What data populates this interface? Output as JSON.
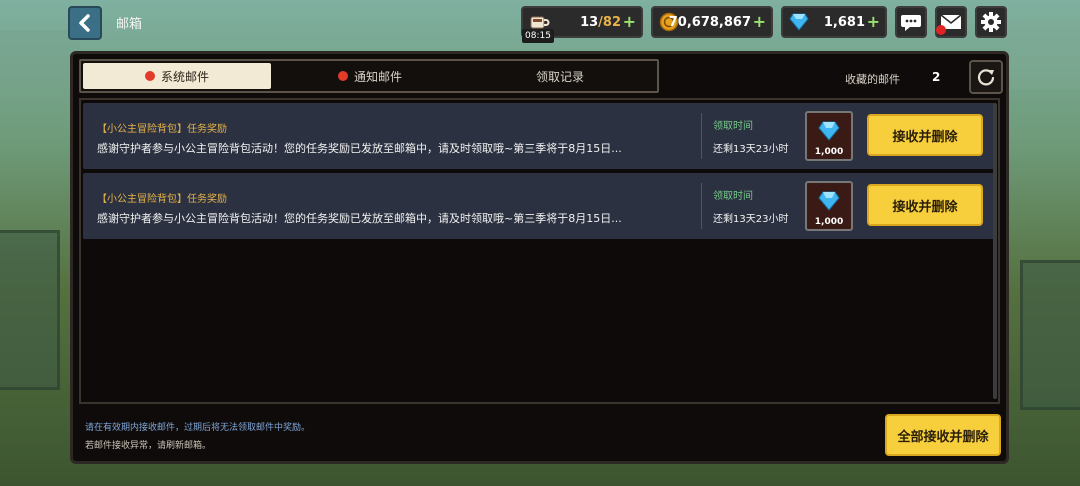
{
  "header": {
    "title": "邮箱"
  },
  "resources": {
    "stamina": {
      "current": "13",
      "max": "/82",
      "timer": "08:15",
      "icon": "coffee-cup-icon"
    },
    "coins": {
      "value": "70,678,867",
      "icon": "coin-icon"
    },
    "gems": {
      "value": "1,681",
      "icon": "diamond-icon"
    }
  },
  "tabs": [
    {
      "label": "系统邮件",
      "active": true,
      "has_dot": true
    },
    {
      "label": "通知邮件",
      "active": false,
      "has_dot": true
    },
    {
      "label": "领取记录",
      "active": false,
      "has_dot": false
    }
  ],
  "favorites": {
    "label": "收藏的邮件",
    "count": "2"
  },
  "mails": [
    {
      "title": "【小公主冒险背包】任务奖励",
      "body": "感谢守护者参与小公主冒险背包活动！您的任务奖励已发放至邮箱中，请及时领取哦~第三季将于8月15日...",
      "claim_label": "领取时间",
      "remaining": "还剩13天23小时",
      "reward_qty": "1,000",
      "button": "接收并删除"
    },
    {
      "title": "【小公主冒险背包】任务奖励",
      "body": "感谢守护者参与小公主冒险背包活动！您的任务奖励已发放至邮箱中，请及时领取哦~第三季将于8月15日...",
      "claim_label": "领取时间",
      "remaining": "还剩13天23小时",
      "reward_qty": "1,000",
      "button": "接收并删除"
    }
  ],
  "footer": {
    "note1": "请在有效期内接收邮件，过期后将无法领取邮件中奖励。",
    "note2": "若邮件接收异常，请刷新邮箱。",
    "accept_all": "全部接收并删除"
  },
  "colors": {
    "accent_yellow": "#f7cf3d",
    "tab_active_bg": "#f3ead5",
    "mail_title": "#e7b34a",
    "claim_label": "#76c88a",
    "notice_blue": "#7fa6d8",
    "red_dot": "#e33a2a"
  }
}
